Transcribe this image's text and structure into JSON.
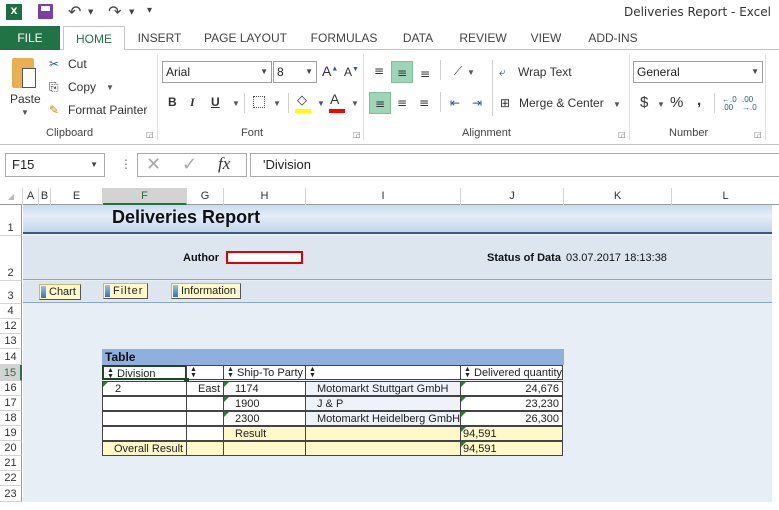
{
  "window": {
    "title": "Deliveries Report - Excel"
  },
  "quick_access": {
    "excel_icon": "excel-icon",
    "save_icon": "save-icon",
    "undo": "↶",
    "redo": "↷",
    "customize": "⩡"
  },
  "tabs": [
    {
      "label": "FILE"
    },
    {
      "label": "HOME"
    },
    {
      "label": "INSERT"
    },
    {
      "label": "PAGE LAYOUT"
    },
    {
      "label": "FORMULAS"
    },
    {
      "label": "DATA"
    },
    {
      "label": "REVIEW"
    },
    {
      "label": "VIEW"
    },
    {
      "label": "ADD-INS"
    }
  ],
  "ribbon": {
    "clipboard": {
      "label": "Clipboard",
      "paste": "Paste",
      "cut": "Cut",
      "copy": "Copy",
      "format_painter": "Format Painter"
    },
    "font": {
      "label": "Font",
      "family": "Arial",
      "size": "8",
      "bold": "B",
      "italic": "I",
      "underline": "U",
      "grow": "A",
      "shrink": "A",
      "font_color": "A"
    },
    "alignment": {
      "label": "Alignment",
      "wrap_text": "Wrap Text",
      "merge_center": "Merge & Center"
    },
    "number": {
      "label": "Number",
      "format": "General",
      "currency": "$",
      "percent": "%",
      "comma": ",",
      "inc_decimal": "←.0 .00",
      "dec_decimal": ".00 →.0"
    }
  },
  "formula_bar": {
    "name_box": "F15",
    "formula": "'Division",
    "cancel": "✕",
    "enter": "✓",
    "fx": "fx"
  },
  "columns": [
    "A",
    "B",
    "E",
    "F",
    "G",
    "H",
    "I",
    "J",
    "K",
    "L"
  ],
  "rows": [
    "1",
    "2",
    "3",
    "4",
    "12",
    "13",
    "14",
    "15",
    "16",
    "17",
    "18",
    "19",
    "20",
    "21",
    "22",
    "23"
  ],
  "report": {
    "title": "Deliveries Report",
    "author_label": "Author",
    "author_value": "",
    "status_label": "Status of Data",
    "status_value": "03.07.2017 18:13:38",
    "buttons": [
      "Chart",
      "Filter",
      "Information"
    ]
  },
  "table": {
    "title": "Table",
    "headers": [
      "Division",
      "",
      "Ship-To Party",
      "",
      "Delivered quantity"
    ],
    "rows": [
      {
        "division": "2",
        "region": "East",
        "party_id": "1174",
        "party_name": "Motomarkt Stuttgart GmbH",
        "qty": "24,676"
      },
      {
        "division": "",
        "region": "",
        "party_id": "1900",
        "party_name": "J & P",
        "qty": "23,230"
      },
      {
        "division": "",
        "region": "",
        "party_id": "2300",
        "party_name": "Motomarkt Heidelberg GmbH",
        "qty": "26,300"
      }
    ],
    "result": {
      "label": "Result",
      "qty": "94,591"
    },
    "overall": {
      "label": "Overall Result",
      "qty": "94,591"
    }
  }
}
